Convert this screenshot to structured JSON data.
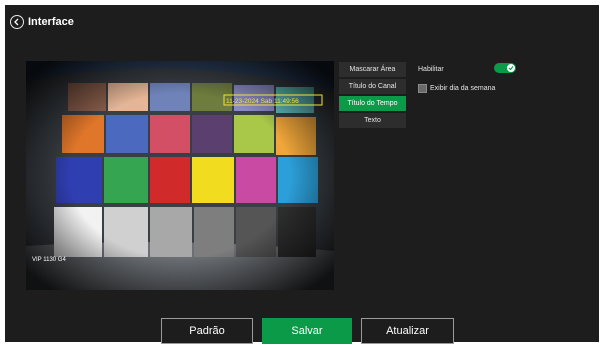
{
  "header": {
    "title": "Interface",
    "back_icon": "chevron-left-icon"
  },
  "video": {
    "osd_channel": "VIP 1130 G4",
    "osd_time": "11-23-2024 Sab 11:49:56"
  },
  "tabs": [
    {
      "label": "Mascarar Área",
      "active": false
    },
    {
      "label": "Título do Canal",
      "active": false
    },
    {
      "label": "Título do Tempo",
      "active": true
    },
    {
      "label": "Texto",
      "active": false
    }
  ],
  "options": {
    "enable_label": "Habilitar",
    "enable_value": true,
    "weekday_label": "Exibir dia da semana",
    "weekday_value": false
  },
  "buttons": {
    "default": "Padrão",
    "save": "Salvar",
    "refresh": "Atualizar"
  },
  "colors": {
    "accent": "#0a9a48",
    "panel": "#1d1d1d"
  }
}
